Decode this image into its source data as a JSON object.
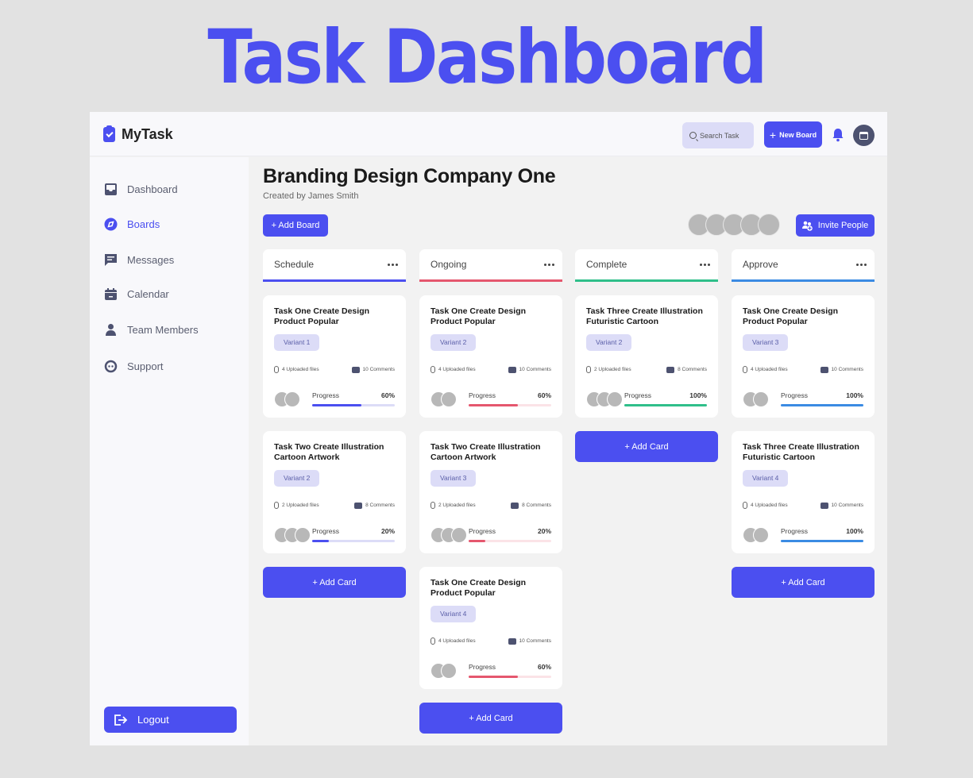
{
  "hero_title": "Task Dashboard",
  "app": {
    "name": "MyTask",
    "search_placeholder": "Search Task",
    "new_board_label": "New Board",
    "new_board_icon": "plus-icon"
  },
  "sidebar": {
    "items": [
      {
        "label": "Dashboard",
        "icon": "inbox-icon",
        "active": false
      },
      {
        "label": "Boards",
        "icon": "compass-icon",
        "active": true
      },
      {
        "label": "Messages",
        "icon": "message-icon",
        "active": false
      },
      {
        "label": "Calendar",
        "icon": "calendar-icon",
        "active": false
      },
      {
        "label": "Team Members",
        "icon": "person-icon",
        "active": false
      },
      {
        "label": "Support",
        "icon": "support-icon",
        "active": false
      }
    ],
    "logout_label": "Logout"
  },
  "board": {
    "title": "Branding Design Company One",
    "created_by": "Created by James Smith",
    "add_board_label": "+ Add Board",
    "invite_label": "Invite People",
    "member_count": 5
  },
  "add_card_label": "+ Add Card",
  "progress_label": "Progress",
  "columns": [
    {
      "name": "Schedule",
      "color": "#4b4ff0",
      "track": "#dcdcf7",
      "cards": [
        {
          "title": "Task One Create Design Product Popular",
          "variant": "Variant 1",
          "files": "4 Uploaded files",
          "comments": "10 Comments",
          "avatars": 2,
          "progress": "60%",
          "progress_value": 60
        },
        {
          "title": "Task Two Create Illustration Cartoon Artwork",
          "variant": "Variant 2",
          "files": "2 Uploaded files",
          "comments": "8 Comments",
          "avatars": 3,
          "progress": "20%",
          "progress_value": 20
        }
      ]
    },
    {
      "name": "Ongoing",
      "color": "#e5576e",
      "track": "#fbe3e7",
      "cards": [
        {
          "title": "Task One Create Design Product Popular",
          "variant": "Variant 2",
          "files": "4 Uploaded files",
          "comments": "10 Comments",
          "avatars": 2,
          "progress": "60%",
          "progress_value": 60
        },
        {
          "title": "Task Two Create Illustration Cartoon Artwork",
          "variant": "Variant 3",
          "files": "2 Uploaded files",
          "comments": "8 Comments",
          "avatars": 3,
          "progress": "20%",
          "progress_value": 20
        },
        {
          "title": "Task One Create Design Product Popular",
          "variant": "Variant 4",
          "files": "4 Uploaded files",
          "comments": "10 Comments",
          "avatars": 2,
          "progress": "60%",
          "progress_value": 60
        }
      ]
    },
    {
      "name": "Complete",
      "color": "#2fbf8a",
      "track": "#d8f3e9",
      "cards": [
        {
          "title": "Task Three Create Illustration Futuristic Cartoon",
          "variant": "Variant 2",
          "files": "2 Uploaded files",
          "comments": "8 Comments",
          "avatars": 3,
          "progress": "100%",
          "progress_value": 100
        }
      ]
    },
    {
      "name": "Approve",
      "color": "#3b8be3",
      "track": "#dbe9fa",
      "cards": [
        {
          "title": "Task One Create Design Product Popular",
          "variant": "Variant 3",
          "files": "4 Uploaded files",
          "comments": "10 Comments",
          "avatars": 2,
          "progress": "100%",
          "progress_value": 100
        },
        {
          "title": "Task Three Create Illustration Futuristic Cartoon",
          "variant": "Variant 4",
          "files": "4 Uploaded files",
          "comments": "10 Comments",
          "avatars": 2,
          "progress": "100%",
          "progress_value": 100
        }
      ]
    }
  ]
}
